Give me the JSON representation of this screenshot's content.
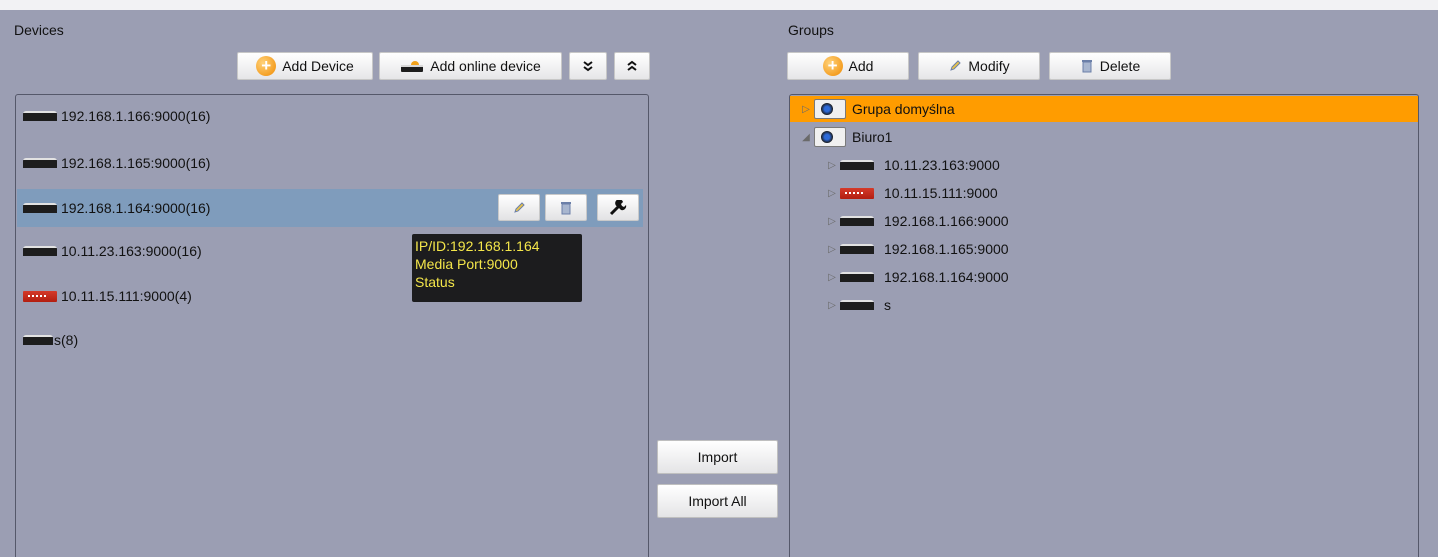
{
  "devices": {
    "title": "Devices",
    "toolbar": {
      "add_device": "Add Device",
      "add_online_device": "Add online device",
      "expand_all": "⌄⌄",
      "collapse_all": "⌃⌃"
    },
    "items": [
      {
        "label": "192.168.1.166:9000(16)",
        "icon": "dvr-icon"
      },
      {
        "label": "192.168.1.165:9000(16)",
        "icon": "dvr-icon"
      },
      {
        "label": "192.168.1.164:9000(16)",
        "icon": "dvr-icon",
        "selected": true
      },
      {
        "label": "10.11.23.163:9000(16)",
        "icon": "dvr-icon"
      },
      {
        "label": "10.11.15.111:9000(4)",
        "icon": "red-dvr-icon"
      },
      {
        "label": "s(8)",
        "icon": "dvr-icon"
      }
    ],
    "tooltip": {
      "line1": "IP/ID:192.168.1.164",
      "line2": "Media Port:9000",
      "line3": "Status"
    }
  },
  "middle": {
    "import": "Import",
    "import_all": "Import All"
  },
  "groups": {
    "title": "Groups",
    "toolbar": {
      "add": "Add",
      "modify": "Modify",
      "delete": "Delete"
    },
    "tree": [
      {
        "label": "Grupa domyślna",
        "type": "group",
        "expanded": false,
        "selected": true
      },
      {
        "label": "Biuro1",
        "type": "group",
        "expanded": true
      },
      {
        "label": "10.11.23.163:9000",
        "type": "device"
      },
      {
        "label": "10.11.15.111:9000",
        "type": "device-red"
      },
      {
        "label": "192.168.1.166:9000",
        "type": "device"
      },
      {
        "label": "192.168.1.165:9000",
        "type": "device"
      },
      {
        "label": "192.168.1.164:9000",
        "type": "device"
      },
      {
        "label": "s",
        "type": "device"
      }
    ]
  },
  "colors": {
    "background": "#9b9eb3",
    "selection_row": "#7f9cbc",
    "group_highlight": "#ff9c00",
    "tooltip_text": "#f4e64a"
  }
}
